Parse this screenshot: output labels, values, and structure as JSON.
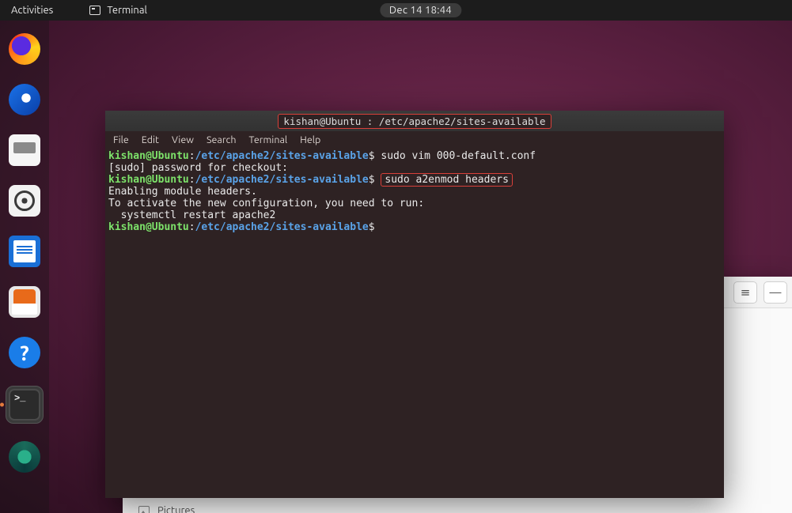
{
  "top_panel": {
    "activities": "Activities",
    "app_label": "Terminal",
    "clock": "Dec 14  18:44"
  },
  "dock": {
    "items": [
      {
        "name": "firefox-icon"
      },
      {
        "name": "thunderbird-icon"
      },
      {
        "name": "files-icon"
      },
      {
        "name": "rhythmbox-icon"
      },
      {
        "name": "writer-icon"
      },
      {
        "name": "software-icon"
      },
      {
        "name": "help-icon"
      },
      {
        "name": "terminal-icon"
      },
      {
        "name": "camera-icon"
      }
    ],
    "help_glyph": "?"
  },
  "file_window": {
    "sidebar_item": "Pictures",
    "btn_menu": "≡",
    "btn_min": "—"
  },
  "terminal": {
    "title_host": "kishan@Ubuntu :",
    "title_path": "/etc/apache2/sites-available",
    "menus": [
      "File",
      "Edit",
      "View",
      "Search",
      "Terminal",
      "Help"
    ],
    "prompt_user": "kishan@Ubuntu",
    "prompt_sep": ":",
    "prompt_path": "/etc/apache2/sites-available",
    "prompt_sigil": "$",
    "line1_cmd": " sudo vim 000-default.conf",
    "line2": "[sudo] password for checkout:",
    "line3_cmd": "sudo a2enmod headers",
    "line4": "Enabling module headers.",
    "line5": "To activate the new configuration, you need to run:",
    "line6": "  systemctl restart apache2"
  }
}
